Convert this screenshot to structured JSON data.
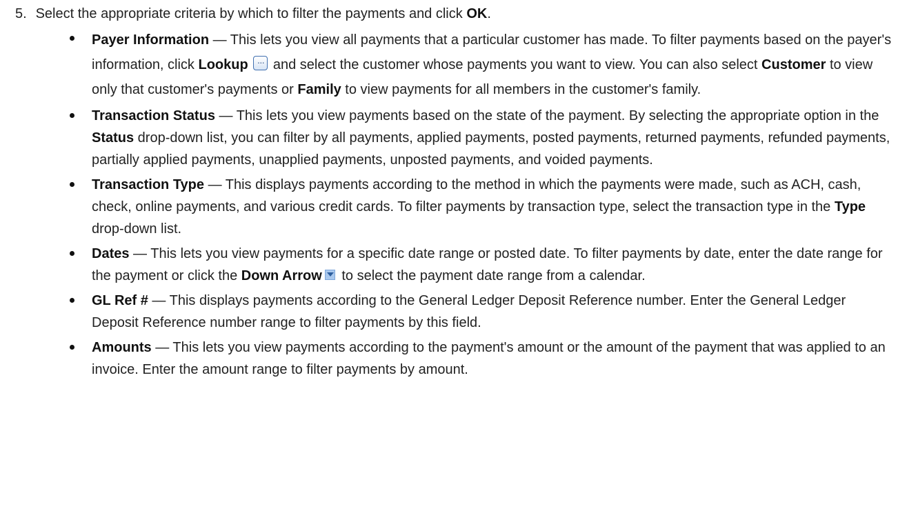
{
  "step": {
    "number": "5.",
    "text_before": "Select the appropriate criteria by which to filter the payments and click ",
    "bold": "OK",
    "text_after": "."
  },
  "bullets": {
    "payer": {
      "title": "Payer Information",
      "t1": " — This lets you view all payments that a particular customer has made. To filter payments based on the payer's information, click ",
      "b1": "Lookup",
      "icon": "lookup-ellipsis-icon",
      "t2": " and select the customer whose payments you want to view. You can also select ",
      "b2": "Customer",
      "t3": " to view only that customer's payments or ",
      "b3": "Family",
      "t4": " to view payments for all members in the customer's family."
    },
    "status": {
      "title": "Transaction Status",
      "t1": " — This lets you view payments based on the state of the payment. By selecting the appropriate option in the ",
      "b1": "Status",
      "t2": " drop-down list, you can filter by all payments, applied payments, posted payments, returned payments, refunded payments, partially applied payments, unapplied payments, unposted payments, and voided payments."
    },
    "type": {
      "title": "Transaction Type",
      "t1": " — This displays payments according to the method in which the payments were made, such as ACH, cash, check, online payments, and various credit cards. To filter payments by transaction type, select the transaction type in the ",
      "b1": "Type",
      "t2": " drop-down list."
    },
    "dates": {
      "title": "Dates",
      "t1": " — This lets you view payments for a specific date range or posted date. To filter payments by date, enter the date range for the payment or click the ",
      "b1": "Down Arrow",
      "icon": "down-arrow-icon",
      "t2": " to select the payment date range from a calendar."
    },
    "glref": {
      "title": "GL Ref #",
      "t1": " — This displays payments according to the General Ledger Deposit Reference number. Enter the General Ledger Deposit Reference number range to filter payments by this field."
    },
    "amounts": {
      "title": "Amounts",
      "t1": " — This lets you view payments according to the payment's amount or the amount of the payment that was applied to an invoice. Enter the amount range to filter payments by amount."
    }
  }
}
